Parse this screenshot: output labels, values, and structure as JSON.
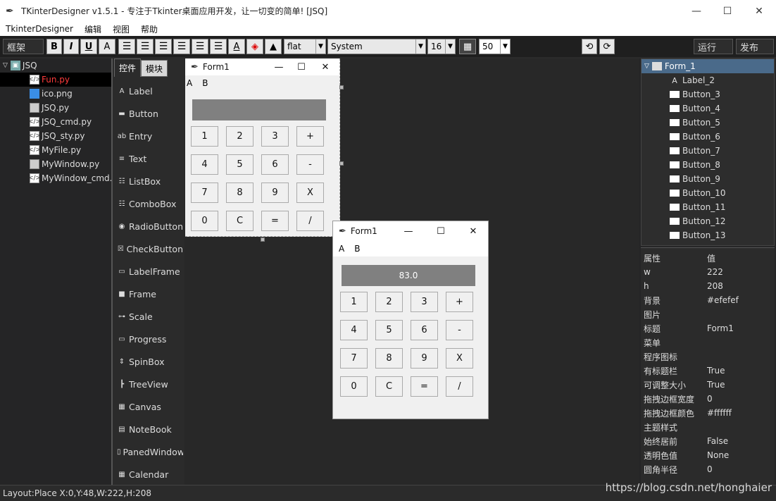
{
  "window": {
    "title": "TKinterDesigner v1.5.1 - 专注于Tkinter桌面应用开发，让一切变的简单!    [JSQ]",
    "min": "—",
    "max": "☐",
    "close": "✕"
  },
  "menu": [
    "TkinterDesigner",
    "编辑",
    "视图",
    "帮助"
  ],
  "toolbar": {
    "frame_label": "框架",
    "bold": "B",
    "italic": "I",
    "underline": "U",
    "font_a": "A",
    "relief": "flat",
    "font_family": "System",
    "font_size": "16",
    "alpha": "50",
    "run": "运行",
    "publish": "发布"
  },
  "filetree": {
    "root": "JSQ",
    "files": [
      {
        "name": "Fun.py",
        "type": "py",
        "selected": true
      },
      {
        "name": "ico.png",
        "type": "png"
      },
      {
        "name": "JSQ.py",
        "type": "frm"
      },
      {
        "name": "JSQ_cmd.py",
        "type": "py"
      },
      {
        "name": "JSQ_sty.py",
        "type": "py"
      },
      {
        "name": "MyFile.py",
        "type": "py"
      },
      {
        "name": "MyWindow.py",
        "type": "frm"
      },
      {
        "name": "MyWindow_cmd.py",
        "type": "py"
      }
    ]
  },
  "controls": {
    "tab_active": "控件",
    "tab_inactive": "模块",
    "items": [
      {
        "label": "Label",
        "icon": "A"
      },
      {
        "label": "Button",
        "icon": "▬"
      },
      {
        "label": "Entry",
        "icon": "ab"
      },
      {
        "label": "Text",
        "icon": "≡"
      },
      {
        "label": "ListBox",
        "icon": "☷"
      },
      {
        "label": "ComboBox",
        "icon": "☷"
      },
      {
        "label": "RadioButton",
        "icon": "◉"
      },
      {
        "label": "CheckButton",
        "icon": "☒"
      },
      {
        "label": "LabelFrame",
        "icon": "▭"
      },
      {
        "label": "Frame",
        "icon": "■"
      },
      {
        "label": "Scale",
        "icon": "⊶"
      },
      {
        "label": "Progress",
        "icon": "▭"
      },
      {
        "label": "SpinBox",
        "icon": "⇕"
      },
      {
        "label": "TreeView",
        "icon": "┣"
      },
      {
        "label": "Canvas",
        "icon": "▦"
      },
      {
        "label": "NoteBook",
        "icon": "▤"
      },
      {
        "label": "PanedWindow",
        "icon": "▯"
      },
      {
        "label": "Calendar",
        "icon": "▦"
      }
    ]
  },
  "form1": {
    "title": "Form1",
    "menu_a": "A",
    "menu_b": "B",
    "display": "",
    "keys": [
      "1",
      "2",
      "3",
      "+",
      "4",
      "5",
      "6",
      "-",
      "7",
      "8",
      "9",
      "X",
      "0",
      "C",
      "=",
      "/"
    ]
  },
  "form2": {
    "title": "Form1",
    "menu_a": "A",
    "menu_b": "B",
    "display": "83.0",
    "keys": [
      "1",
      "2",
      "3",
      "+",
      "4",
      "5",
      "6",
      "-",
      "7",
      "8",
      "9",
      "X",
      "0",
      "C",
      "=",
      "/"
    ]
  },
  "objtree": {
    "root": "Form_1",
    "items": [
      "Label_2",
      "Button_3",
      "Button_4",
      "Button_5",
      "Button_6",
      "Button_7",
      "Button_8",
      "Button_9",
      "Button_10",
      "Button_11",
      "Button_12",
      "Button_13"
    ]
  },
  "props": {
    "header_key": "属性",
    "header_val": "值",
    "rows": [
      {
        "k": "w",
        "v": "222"
      },
      {
        "k": "h",
        "v": "208"
      },
      {
        "k": "背景",
        "v": "#efefef"
      },
      {
        "k": "图片",
        "v": ""
      },
      {
        "k": "标题",
        "v": "Form1"
      },
      {
        "k": "菜单",
        "v": ""
      },
      {
        "k": "程序图标",
        "v": ""
      },
      {
        "k": "有标题栏",
        "v": "True"
      },
      {
        "k": "可调整大小",
        "v": "True"
      },
      {
        "k": "拖拽边框宽度",
        "v": "0"
      },
      {
        "k": "拖拽边框颜色",
        "v": "#ffffff"
      },
      {
        "k": "主题样式",
        "v": ""
      },
      {
        "k": "始终居前",
        "v": "False"
      },
      {
        "k": "透明色值",
        "v": "None"
      },
      {
        "k": "圆角半径",
        "v": "0"
      }
    ]
  },
  "status": "Layout:Place  X:0,Y:48,W:222,H:208",
  "watermark": "https://blog.csdn.net/honghaier"
}
